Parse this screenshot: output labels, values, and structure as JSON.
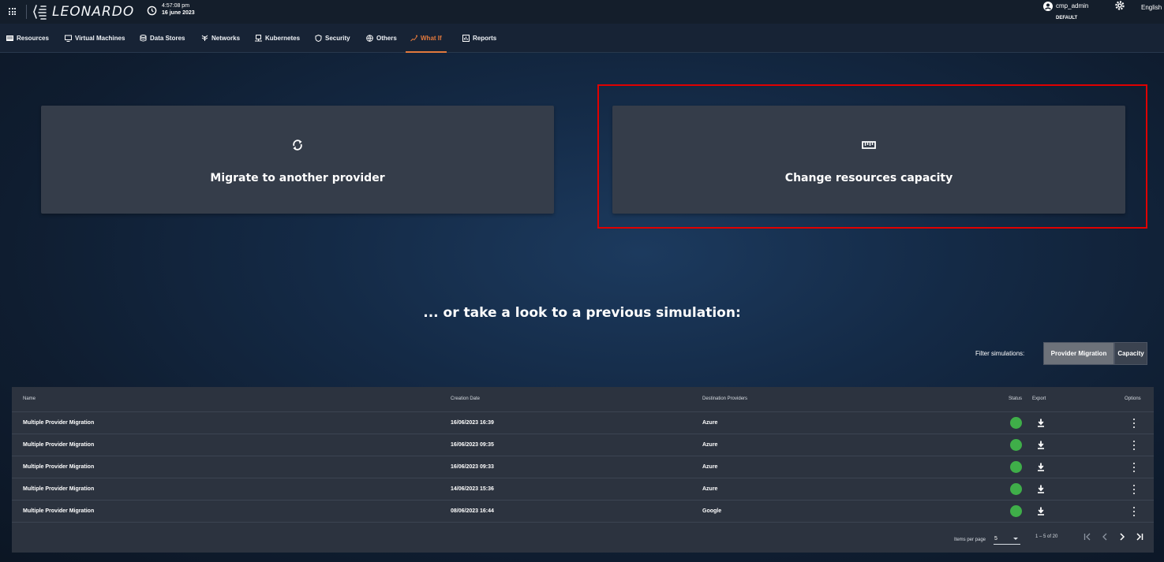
{
  "header": {
    "logo_text": "LEONARDO",
    "time": "4:57:08 pm",
    "date": "16 june 2023",
    "user_name": "cmp_admin",
    "user_role": "DEFAULT",
    "language": "English"
  },
  "nav": {
    "items": [
      {
        "label": "Resources",
        "icon": "server-icon"
      },
      {
        "label": "Virtual Machines",
        "icon": "monitor-icon"
      },
      {
        "label": "Data Stores",
        "icon": "database-icon"
      },
      {
        "label": "Networks",
        "icon": "network-icon"
      },
      {
        "label": "Kubernetes",
        "icon": "kubernetes-icon"
      },
      {
        "label": "Security",
        "icon": "shield-icon"
      },
      {
        "label": "Others",
        "icon": "globe-icon"
      },
      {
        "label": "What If",
        "icon": "whatif-icon",
        "active": true
      },
      {
        "label": "Reports",
        "icon": "report-icon"
      }
    ],
    "accent_color": "#e2793d"
  },
  "cards": {
    "migrate": {
      "label": "Migrate to another provider",
      "icon": "sync-icon"
    },
    "capacity": {
      "label": "Change resources capacity",
      "icon": "ruler-icon"
    }
  },
  "subtitle": "... or take a look to a previous simulation:",
  "filter": {
    "label": "Filter simulations:",
    "options": [
      "Provider Migration",
      "Capacity"
    ],
    "selected": "Provider Migration"
  },
  "table": {
    "columns": {
      "name": "Name",
      "creation_date": "Creation Date",
      "destination": "Destination Providers",
      "status": "Status",
      "export": "Export",
      "options": "Options"
    },
    "rows": [
      {
        "name": "Multiple Provider Migration",
        "date": "16/06/2023 16:39",
        "dest": "Azure",
        "status": "complete"
      },
      {
        "name": "Multiple Provider Migration",
        "date": "16/06/2023 09:35",
        "dest": "Azure",
        "status": "complete"
      },
      {
        "name": "Multiple Provider Migration",
        "date": "16/06/2023 09:33",
        "dest": "Azure",
        "status": "complete"
      },
      {
        "name": "Multiple Provider Migration",
        "date": "14/06/2023 15:36",
        "dest": "Azure",
        "status": "complete"
      },
      {
        "name": "Multiple Provider Migration",
        "date": "08/06/2023 16:44",
        "dest": "Google",
        "status": "complete"
      }
    ],
    "status_color": "#3fae49"
  },
  "paginator": {
    "items_per_page_label": "Items per page",
    "page_size": "5",
    "range": "1 – 5 of 20"
  }
}
